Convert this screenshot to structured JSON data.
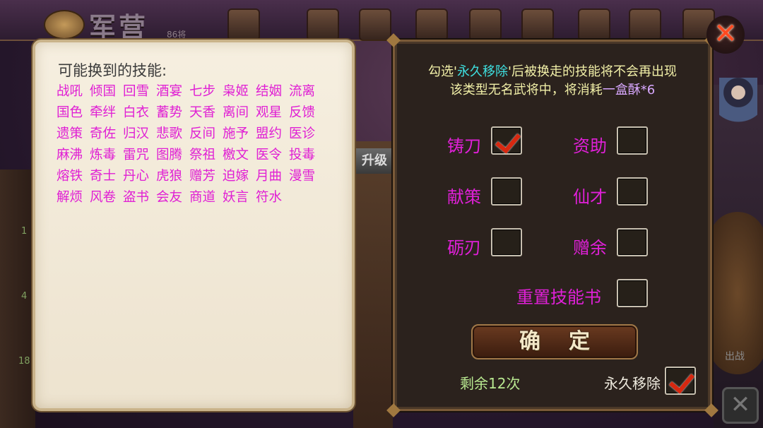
{
  "background": {
    "camp_title": "军营",
    "camp_count": "86将",
    "upgrade_tag": "升级",
    "side_numbers": [
      "1",
      "4",
      "18"
    ],
    "battle_text": "出战"
  },
  "left_panel": {
    "title": "可能换到的技能:",
    "skills": [
      "战吼",
      "倾国",
      "回雪",
      "酒宴",
      "七步",
      "枭姬",
      "结姻",
      "流离",
      "国色",
      "牵绊",
      "白衣",
      "蓄势",
      "天香",
      "离间",
      "观星",
      "反馈",
      "遗策",
      "奇佐",
      "归汉",
      "悲歌",
      "反间",
      "施予",
      "盟约",
      "医诊",
      "麻沸",
      "炼毒",
      "雷咒",
      "图腾",
      "祭祖",
      "檄文",
      "医令",
      "投毒",
      "熔铁",
      "奇士",
      "丹心",
      "虎狼",
      "赠芳",
      "迫嫁",
      "月曲",
      "漫雪",
      "解烦",
      "风卷",
      "盗书",
      "会友",
      "商道",
      "妖言",
      "符水"
    ]
  },
  "right_panel": {
    "info_line1_prefix": "勾选'",
    "info_line1_highlight": "永久移除",
    "info_line1_suffix": "'后被换走的技能将不会再出现",
    "info_line2_prefix": "该类型无名武将中，将消耗",
    "info_line2_highlight": "一盒酥*6",
    "options": [
      {
        "label": "铸刀",
        "checked": true
      },
      {
        "label": "资助",
        "checked": false
      },
      {
        "label": "献策",
        "checked": false
      },
      {
        "label": "仙才",
        "checked": false
      },
      {
        "label": "砺刃",
        "checked": false
      },
      {
        "label": "赠余",
        "checked": false
      },
      {
        "label": "重置技能书",
        "checked": false
      }
    ],
    "confirm_label": "确定",
    "remaining": "剩余12次",
    "permanent_label": "永久移除",
    "permanent_checked": true
  },
  "icons": {
    "close": "close-icon",
    "bottom_close": "close-icon",
    "check": "checkmark-icon"
  },
  "colors": {
    "skill_text": "#e01fd4",
    "option_text": "#e020d8",
    "info_text": "#f2f0a8",
    "highlight": "#3ee0e0",
    "remaining_text": "#b8e890",
    "close_red": "#ff4a20"
  }
}
